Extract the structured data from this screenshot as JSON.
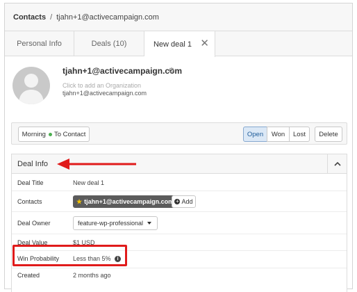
{
  "breadcrumb": {
    "root": "Contacts",
    "separator": "/",
    "current": "tjahn+1@activecampaign.com"
  },
  "tabs": [
    {
      "label": "Personal Info"
    },
    {
      "label": "Deals (10)"
    },
    {
      "label": "New deal 1",
      "close": "✕"
    }
  ],
  "contact": {
    "name": "tjahn+1@activecampaign.com",
    "add_org": "Click to add an Organization",
    "email": "tjahn+1@activecampaign.com"
  },
  "actions": {
    "stage_pipeline": "Morning",
    "stage_name": "To Contact",
    "open": "Open",
    "won": "Won",
    "lost": "Lost",
    "delete": "Delete"
  },
  "deal_info": {
    "title": "Deal Info",
    "rows": {
      "deal_title": {
        "label": "Deal Title",
        "value": "New deal 1"
      },
      "contacts": {
        "label": "Contacts",
        "chip": "tjahn+1@activecampaign.com",
        "add": "Add"
      },
      "deal_owner": {
        "label": "Deal Owner",
        "value": "feature-wp-professional"
      },
      "deal_value": {
        "label": "Deal Value",
        "value": "$1 USD"
      },
      "win_probability": {
        "label": "Win Probability",
        "value": "Less than 5%"
      },
      "created": {
        "label": "Created",
        "value": "2 months ago"
      }
    }
  },
  "annotation_color": "#e01b1b",
  "stage_dot_color": "#4caf50"
}
